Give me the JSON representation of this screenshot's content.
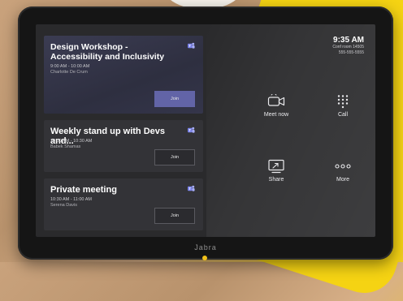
{
  "brand": "Jabra",
  "status": {
    "time": "9:35 AM",
    "room": "Conf room 14505",
    "phone": "555-555-5555"
  },
  "meetings": [
    {
      "title": "Design Workshop - Accessibility and Inclusivity",
      "time": "9:00 AM - 10:00 AM",
      "host": "Charlotte De Crum",
      "join_label": "Join"
    },
    {
      "title": "Weekly stand up with Devs and...",
      "time": "10:00 AM - 10:30 AM",
      "host": "Babek Shamas",
      "join_label": "Join"
    },
    {
      "title": "Private meeting",
      "time": "10:30 AM - 11:00 AM",
      "host": "Serena Davis",
      "join_label": "Join"
    }
  ],
  "actions": {
    "meet_now": "Meet now",
    "call": "Call",
    "share": "Share",
    "more": "More"
  },
  "colors": {
    "accent": "#6264a7",
    "screen_bg": "#2a2a2c",
    "card_bg": "#333337"
  },
  "icons": [
    "teams-icon",
    "video-camera-icon",
    "dialpad-icon",
    "screen-share-icon",
    "more-dots-icon"
  ]
}
